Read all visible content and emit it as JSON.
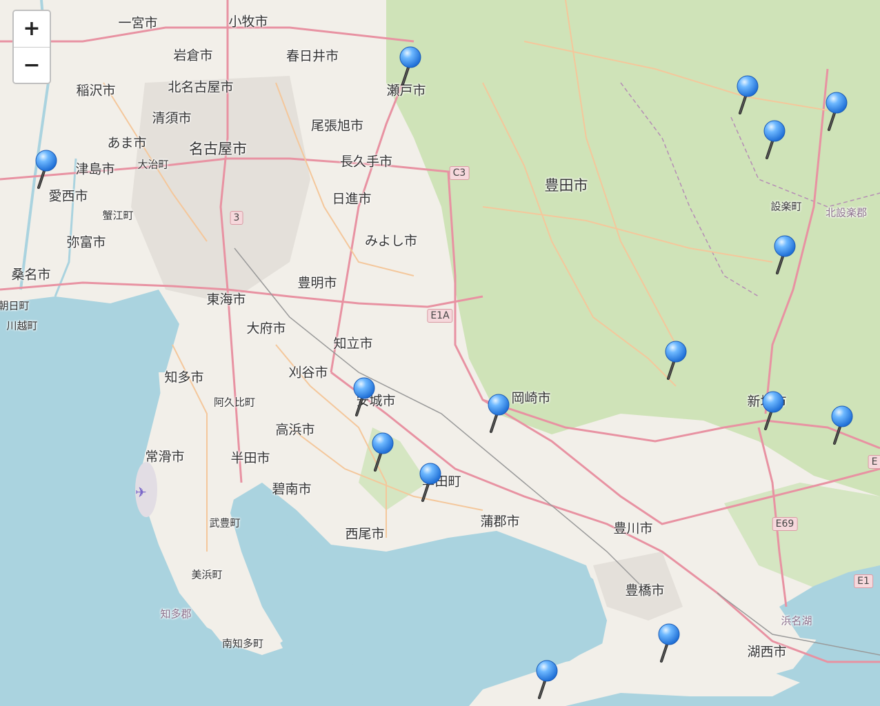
{
  "zoom": {
    "in_label": "+",
    "out_label": "−"
  },
  "labels": [
    {
      "id": "ichinomiya",
      "text": "一宮市",
      "cls": ""
    },
    {
      "id": "komaki",
      "text": "小牧市",
      "cls": ""
    },
    {
      "id": "iwakura",
      "text": "岩倉市",
      "cls": ""
    },
    {
      "id": "kasugai",
      "text": "春日井市",
      "cls": ""
    },
    {
      "id": "seto",
      "text": "瀬戸市",
      "cls": ""
    },
    {
      "id": "inazawa",
      "text": "稲沢市",
      "cls": ""
    },
    {
      "id": "kitanagoya",
      "text": "北名古屋市",
      "cls": ""
    },
    {
      "id": "kiyosu",
      "text": "清須市",
      "cls": ""
    },
    {
      "id": "owariasahi",
      "text": "尾張旭市",
      "cls": ""
    },
    {
      "id": "ama",
      "text": "あま市",
      "cls": ""
    },
    {
      "id": "nagoya",
      "text": "名古屋市",
      "cls": ""
    },
    {
      "id": "oharu",
      "text": "大治町",
      "cls": "small"
    },
    {
      "id": "tsushima",
      "text": "津島市",
      "cls": ""
    },
    {
      "id": "nagakute",
      "text": "長久手市",
      "cls": ""
    },
    {
      "id": "aisai",
      "text": "愛西市",
      "cls": ""
    },
    {
      "id": "kanie",
      "text": "蟹江町",
      "cls": "small"
    },
    {
      "id": "nisshin",
      "text": "日進市",
      "cls": ""
    },
    {
      "id": "toyota",
      "text": "豊田市",
      "cls": ""
    },
    {
      "id": "shitara",
      "text": "設楽町",
      "cls": "small"
    },
    {
      "id": "kitashitara",
      "text": "北設楽郡",
      "cls": "muted"
    },
    {
      "id": "yatomi",
      "text": "弥富市",
      "cls": ""
    },
    {
      "id": "miyoshi",
      "text": "みよし市",
      "cls": ""
    },
    {
      "id": "kuwana",
      "text": "桑名市",
      "cls": ""
    },
    {
      "id": "toyoake",
      "text": "豊明市",
      "cls": ""
    },
    {
      "id": "tokai",
      "text": "東海市",
      "cls": ""
    },
    {
      "id": "asahi",
      "text": "朝日町",
      "cls": "small"
    },
    {
      "id": "kawagoe",
      "text": "川越町",
      "cls": "small"
    },
    {
      "id": "obu",
      "text": "大府市",
      "cls": ""
    },
    {
      "id": "chiryu",
      "text": "知立市",
      "cls": ""
    },
    {
      "id": "chita",
      "text": "知多市",
      "cls": ""
    },
    {
      "id": "kariya",
      "text": "刈谷市",
      "cls": ""
    },
    {
      "id": "anjo",
      "text": "安城市",
      "cls": ""
    },
    {
      "id": "okazaki",
      "text": "岡崎市",
      "cls": ""
    },
    {
      "id": "shinshiro",
      "text": "新城市",
      "cls": ""
    },
    {
      "id": "agui",
      "text": "阿久比町",
      "cls": "small"
    },
    {
      "id": "takahama",
      "text": "高浜市",
      "cls": ""
    },
    {
      "id": "tokoname",
      "text": "常滑市",
      "cls": ""
    },
    {
      "id": "handa",
      "text": "半田市",
      "cls": ""
    },
    {
      "id": "hekinan",
      "text": "碧南市",
      "cls": ""
    },
    {
      "id": "kota",
      "text": "幸田町",
      "cls": ""
    },
    {
      "id": "gamagori",
      "text": "蒲郡市",
      "cls": ""
    },
    {
      "id": "taketoyo",
      "text": "武豊町",
      "cls": "small"
    },
    {
      "id": "toyokawa",
      "text": "豊川市",
      "cls": ""
    },
    {
      "id": "nishio",
      "text": "西尾市",
      "cls": ""
    },
    {
      "id": "mihama",
      "text": "美浜町",
      "cls": "small"
    },
    {
      "id": "chitagun",
      "text": "知多郡",
      "cls": "muted"
    },
    {
      "id": "toyohashi",
      "text": "豊橋市",
      "cls": ""
    },
    {
      "id": "hamanako",
      "text": "浜名湖",
      "cls": "muted"
    },
    {
      "id": "kosai",
      "text": "湖西市",
      "cls": ""
    },
    {
      "id": "minamichita",
      "text": "南知多町",
      "cls": "small"
    }
  ],
  "shields": [
    {
      "id": "c3",
      "text": "C3"
    },
    {
      "id": "r3",
      "text": "3"
    },
    {
      "id": "e1a",
      "text": "E1A"
    },
    {
      "id": "e69",
      "text": "E69"
    },
    {
      "id": "e1",
      "text": "E1"
    },
    {
      "id": "e4",
      "text": "E"
    }
  ],
  "marker_count": 16
}
